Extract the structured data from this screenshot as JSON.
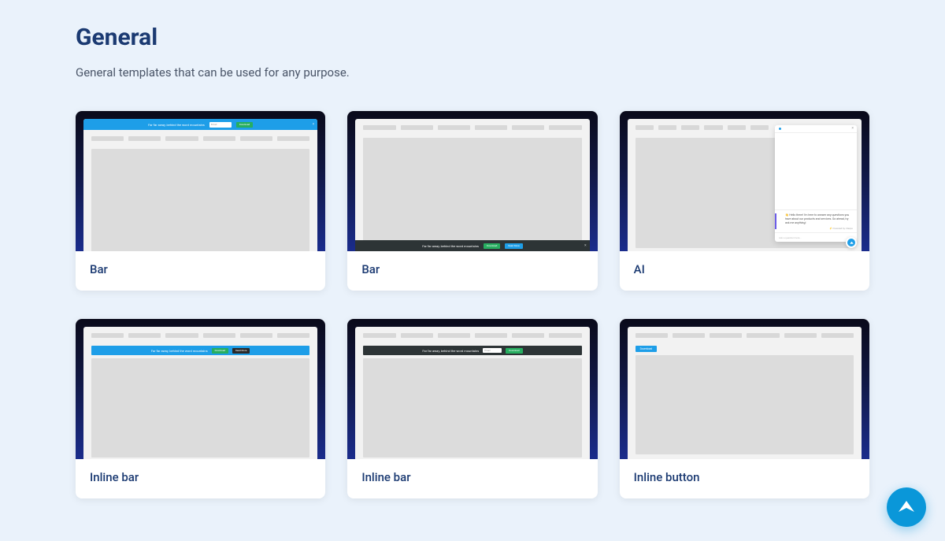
{
  "section": {
    "title": "General",
    "subtitle": "General templates that can be used for any purpose."
  },
  "bar_demo": {
    "message": "Far far away, behind the word mountains",
    "input_placeholder": "Email",
    "btn_primary": "Download",
    "btn_secondary": "Read More"
  },
  "ai_demo": {
    "greeting": "👋 Hello there! I'm here to answer any questions you have about our products and services. Go ahead, try ask me anything!",
    "powered_by": "⚡ Powered by Claspo",
    "input_placeholder": "Ask a question here..."
  },
  "inline_button_demo": {
    "label": "Download"
  },
  "cards": [
    {
      "label": "Bar"
    },
    {
      "label": "Bar"
    },
    {
      "label": "AI"
    },
    {
      "label": "Inline bar"
    },
    {
      "label": "Inline bar"
    },
    {
      "label": "Inline button"
    }
  ]
}
